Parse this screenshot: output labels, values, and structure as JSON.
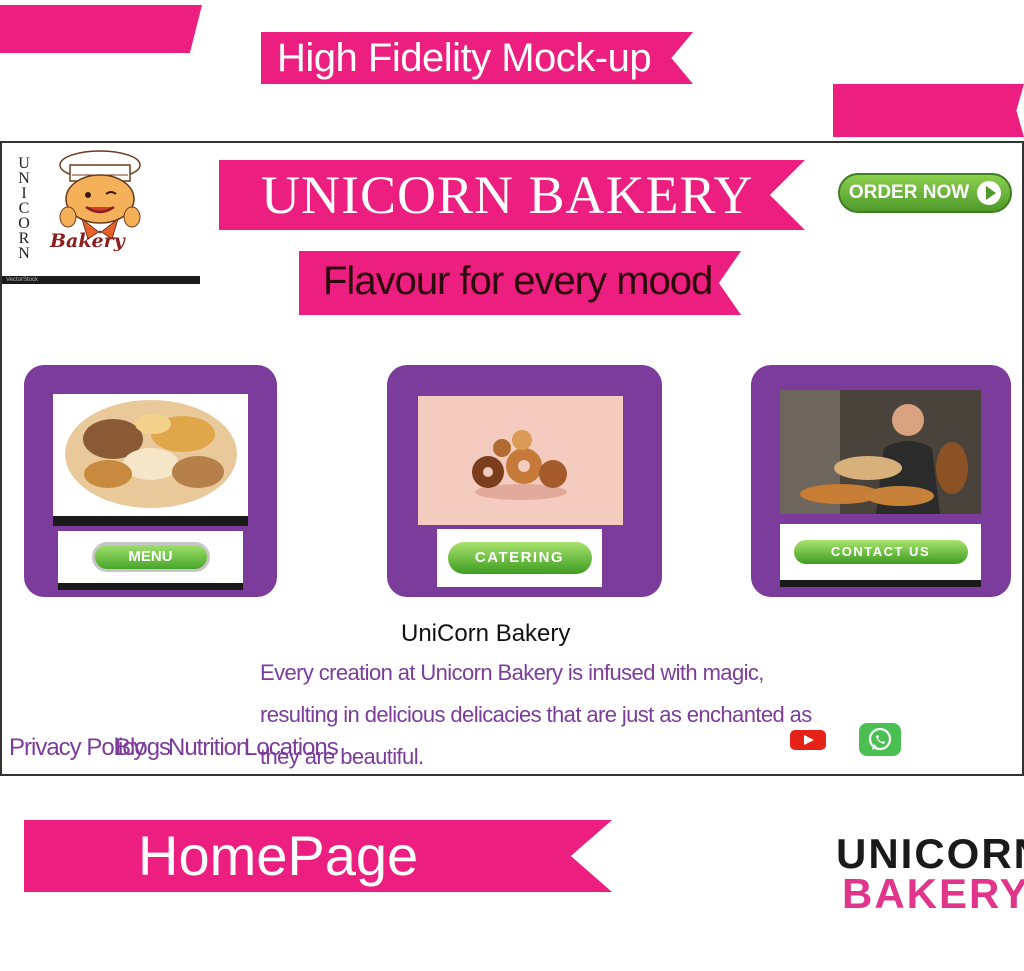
{
  "header": {
    "title": "High Fidelity Mock-up"
  },
  "site": {
    "brand_title": "UNICORN BAKERY",
    "tagline": "Flavour for every mood",
    "order_button": "ORDER NOW",
    "logo_vertical": [
      "U",
      "N",
      "I",
      "C",
      "O",
      "R",
      "N"
    ],
    "logo_script": "Bakery",
    "logo_watermark": "VectorStock",
    "cards": [
      {
        "button": "MENU"
      },
      {
        "button": "CATERING"
      },
      {
        "button": "CONTACT US"
      }
    ],
    "company_name": "UniCorn Bakery",
    "description": "Every creation at Unicorn Bakery is infused with magic, resulting in delicious delicacies that are just as enchanted as they are beautiful.",
    "footer_links": [
      "Privacy Policy",
      "Blogs",
      "Nutrition",
      "Locations"
    ],
    "social_icons": [
      "youtube-icon",
      "whatsapp-icon"
    ]
  },
  "page_label": "HomePage",
  "brand_logo": {
    "line1": "UNICORN",
    "line2": "BAKERY"
  },
  "colors": {
    "pink": "#ec1e7f",
    "purple": "#7c3c9b",
    "green": "#4f9a2b"
  }
}
